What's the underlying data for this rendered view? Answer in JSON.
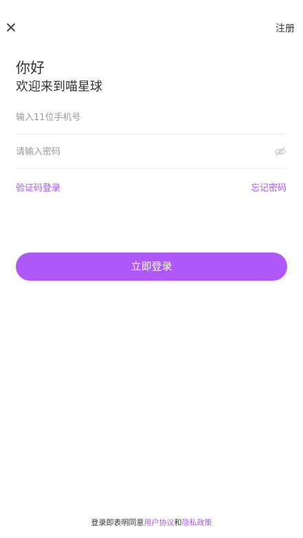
{
  "header": {
    "close_icon": "close-icon",
    "register_label": "注册"
  },
  "greeting": {
    "line1": "你好",
    "line2": "欢迎来到喵星球"
  },
  "form": {
    "phone_placeholder": "输入11位手机号",
    "phone_value": "",
    "password_placeholder": "请输入密码",
    "password_value": "",
    "password_toggle_icon": "eye-hidden-icon"
  },
  "links": {
    "sms_login": "验证码登录",
    "forgot_password": "忘记密码"
  },
  "login_button": "立即登录",
  "agreement": {
    "prefix": "登录即表明同意",
    "user_agreement": "用户协议",
    "and": "和",
    "privacy_policy": "隐私政策"
  },
  "colors": {
    "accent": "#ad58f7",
    "link": "#a955f5",
    "text": "#333333",
    "placeholder": "#999999"
  }
}
